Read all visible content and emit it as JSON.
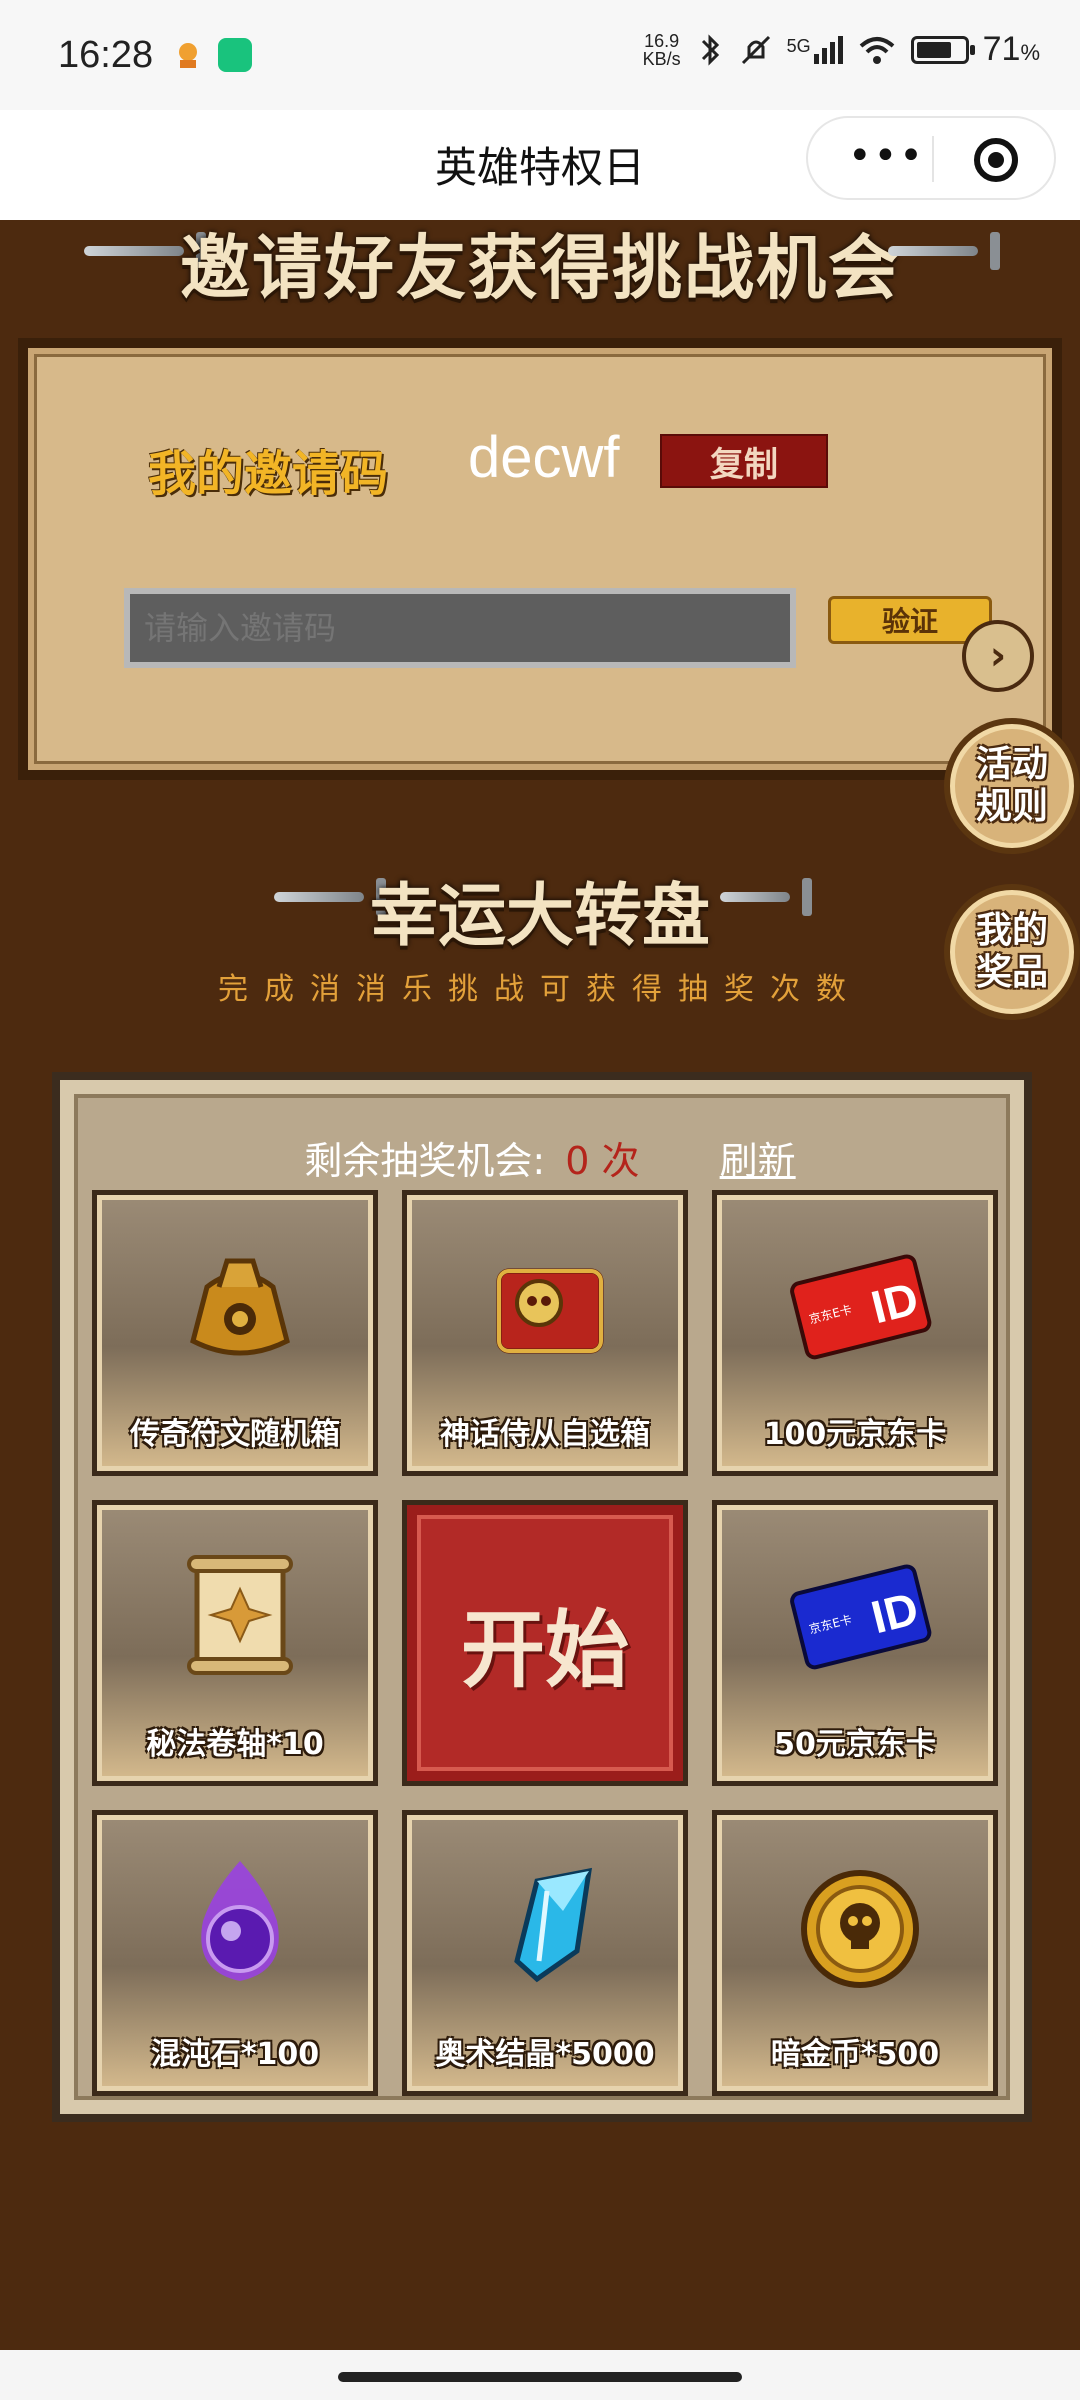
{
  "status_bar": {
    "time": "16:28",
    "speed_value": "16.9",
    "speed_unit": "KB/s",
    "network": "5G",
    "battery_percent": "71",
    "battery_suffix": "%"
  },
  "nav": {
    "title": "英雄特权日",
    "more_icon": "more-dots-icon",
    "close_icon": "target-icon"
  },
  "invite": {
    "title": "邀请好友获得挑战机会",
    "label": "我的邀请码",
    "code": "decwf",
    "copy_label": "复制",
    "input_placeholder": "请输入邀请码",
    "verify_label": "验证"
  },
  "side_buttons": {
    "rules": "活动规则",
    "prizes": "我的奖品"
  },
  "wheel": {
    "title": "幸运大转盘",
    "subtitle": "完成消消乐挑战可获得抽奖次数",
    "chances_label": "剩余抽奖机会:",
    "chances_value": "0",
    "chances_unit": "次",
    "refresh_label": "刷新",
    "start_label": "开始",
    "prizes": [
      {
        "label": "传奇符文随机箱",
        "icon": "treasure-bag-icon"
      },
      {
        "label": "神话侍从自选箱",
        "icon": "skull-chest-icon"
      },
      {
        "label": "100元京东卡",
        "icon": "red-gift-card-icon"
      },
      {
        "label": "秘法卷轴*10",
        "icon": "scroll-icon"
      },
      {
        "label": "50元京东卡",
        "icon": "blue-gift-card-icon"
      },
      {
        "label": "混沌石*100",
        "icon": "purple-orb-icon"
      },
      {
        "label": "奥术结晶*5000",
        "icon": "crystal-icon"
      },
      {
        "label": "暗金币*500",
        "icon": "skull-coin-icon"
      }
    ]
  },
  "colors": {
    "background": "#4d2a0f",
    "accent_gold": "#f2b526",
    "copy_red": "#8b1410",
    "start_red": "#b22a27"
  }
}
